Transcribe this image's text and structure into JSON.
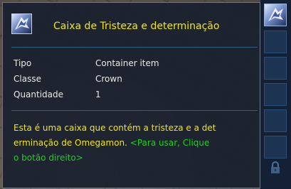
{
  "tooltip": {
    "icon": "omegamon-item-icon",
    "title": "Caixa de Tristeza e determinação",
    "rows": [
      {
        "label": "Tipo",
        "value": "Container item"
      },
      {
        "label": "Classe",
        "value": "Crown"
      },
      {
        "label": "Quantidade",
        "value": "1"
      }
    ],
    "description": {
      "text_line1": "Esta é uma caixa que contém a tristeza e a det",
      "text_line2": "erminação de Omegamon.",
      "hint_part1": "<Para usar, Clique",
      "hint_part2": "o botão direito>"
    },
    "colors": {
      "title": "#f1e41c",
      "description": "#f1e41c",
      "hint": "#1fd11f",
      "text": "#e8e8e8",
      "panel": "#1a212e"
    }
  },
  "inventory": {
    "selected_item_icon": "omegamon-item-icon",
    "lock_icon": "lock-icon"
  }
}
